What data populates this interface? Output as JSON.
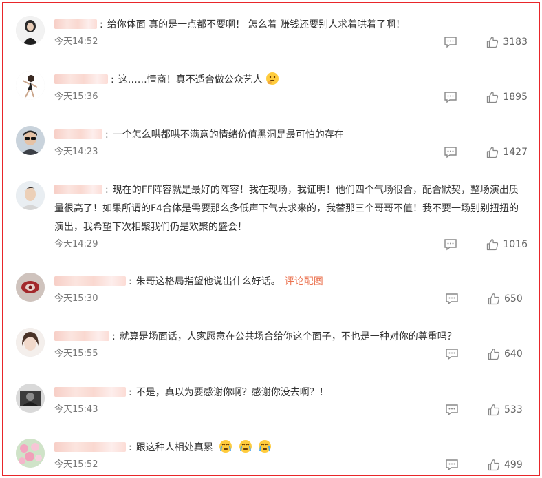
{
  "colors": {
    "border": "#e8262a",
    "text": "#333333",
    "meta": "#777777",
    "link": "#eb7350"
  },
  "comments": [
    {
      "text": "给你体面 真的是一点都不要啊！ 怎么着 赚钱还要别人求着哄着了啊！",
      "time": "今天14:52",
      "likes": "3183",
      "avatar": "avatar-girl-dark-hair"
    },
    {
      "text": "这……情商！真不适合做公众艺人",
      "time": "今天15:36",
      "likes": "1895",
      "emoji": "thinking-face",
      "avatar": "avatar-girl-dancing"
    },
    {
      "text": "一个怎么哄都哄不满意的情绪价值黑洞是最可怕的存在",
      "time": "今天14:23",
      "likes": "1427",
      "avatar": "avatar-man-glasses"
    },
    {
      "text": "现在的FF阵容就是最好的阵容！我在现场，我证明！他们四个气场很合，配合默契，整场演出质量很高了！如果所谓的F4合体是需要那么多低声下气去求来的，我替那三个哥哥不值！我不要一场别别扭扭的演出，我希望下次相聚我们仍是欢聚的盛会！",
      "time": "今天14:29",
      "likes": "1016",
      "avatar": "avatar-man-portrait"
    },
    {
      "text": "朱哥这格局指望他说出什么好话。",
      "link": "评论配图",
      "time": "今天15:30",
      "likes": "650",
      "avatar": "avatar-red-pattern"
    },
    {
      "text": "就算是场面话，人家愿意在公共场合给你这个面子，不也是一种对你的尊重吗？",
      "time": "今天15:55",
      "likes": "640",
      "avatar": "avatar-girl-selfie"
    },
    {
      "text": "不是，真以为要感谢你啊？感谢你没去啊？！",
      "time": "今天15:43",
      "likes": "533",
      "avatar": "avatar-dark-photo"
    },
    {
      "text": "跟这种人相处真累",
      "emoji_count": 3,
      "emoji": "crying-face",
      "time": "今天15:52",
      "likes": "499",
      "avatar": "avatar-flowers"
    }
  ]
}
